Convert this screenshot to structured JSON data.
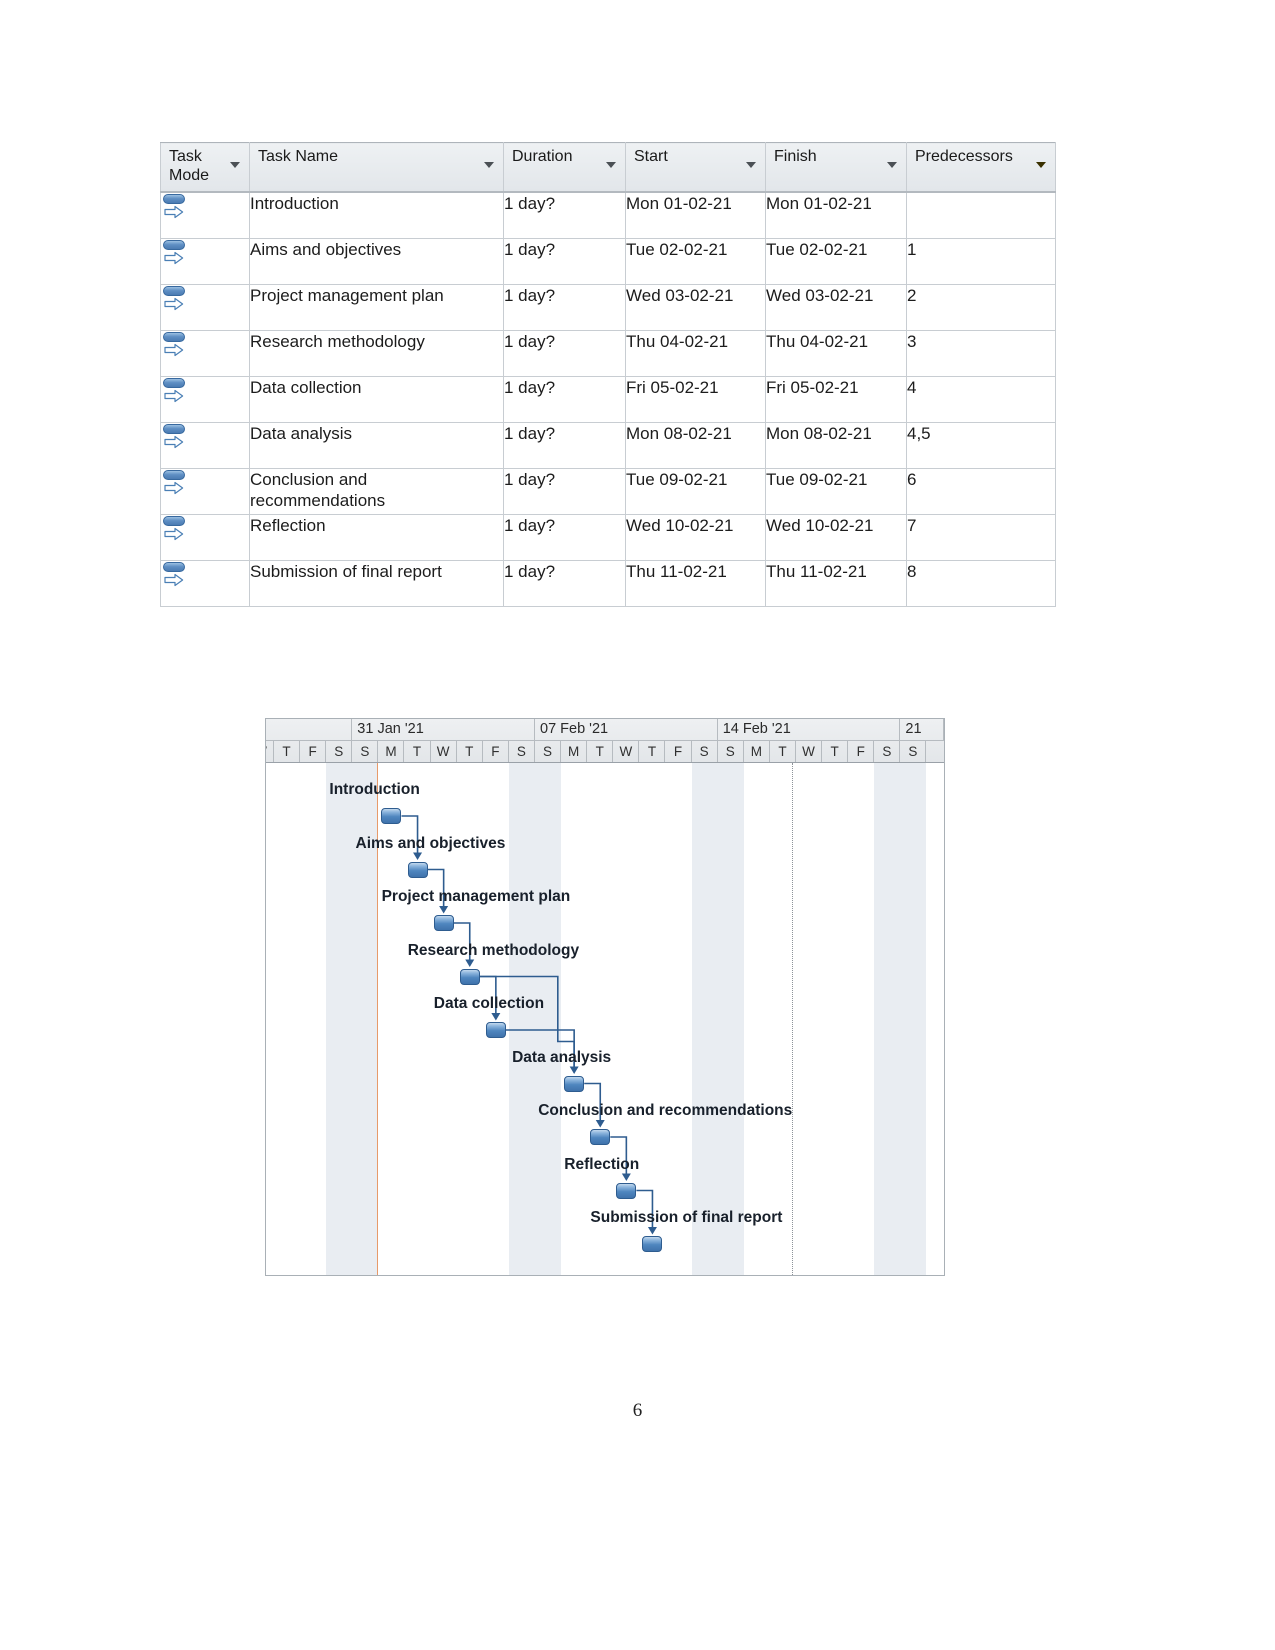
{
  "table": {
    "columns": [
      {
        "id": "task_mode",
        "label": "Task Mode",
        "has_filter": true,
        "highlight": false
      },
      {
        "id": "task_name",
        "label": "Task Name",
        "has_filter": true,
        "highlight": false
      },
      {
        "id": "duration",
        "label": "Duration",
        "has_filter": true,
        "highlight": false
      },
      {
        "id": "start",
        "label": "Start",
        "has_filter": true,
        "highlight": false
      },
      {
        "id": "finish",
        "label": "Finish",
        "has_filter": true,
        "highlight": false
      },
      {
        "id": "predecessors",
        "label": "Predecessors",
        "has_filter": true,
        "highlight": true
      }
    ],
    "highlight_color": "#ffd966",
    "rows": [
      {
        "mode_icon": "manually-scheduled-icon",
        "name": "Introduction",
        "duration": "1 day?",
        "start": "Mon 01-02-21",
        "finish": "Mon 01-02-21",
        "predecessors": ""
      },
      {
        "mode_icon": "manually-scheduled-icon",
        "name": "Aims and objectives",
        "duration": "1 day?",
        "start": "Tue 02-02-21",
        "finish": "Tue 02-02-21",
        "predecessors": "1"
      },
      {
        "mode_icon": "manually-scheduled-icon",
        "name": "Project management plan",
        "duration": "1 day?",
        "start": "Wed 03-02-21",
        "finish": "Wed 03-02-21",
        "predecessors": "2"
      },
      {
        "mode_icon": "manually-scheduled-icon",
        "name": "Research methodology",
        "duration": "1 day?",
        "start": "Thu 04-02-21",
        "finish": "Thu 04-02-21",
        "predecessors": "3"
      },
      {
        "mode_icon": "manually-scheduled-icon",
        "name": "Data collection",
        "duration": "1 day?",
        "start": "Fri 05-02-21",
        "finish": "Fri 05-02-21",
        "predecessors": "4"
      },
      {
        "mode_icon": "manually-scheduled-icon",
        "name": "Data analysis",
        "duration": "1 day?",
        "start": "Mon 08-02-21",
        "finish": "Mon 08-02-21",
        "predecessors": "4,5"
      },
      {
        "mode_icon": "manually-scheduled-icon",
        "name": "Conclusion and recommendations",
        "duration": "1 day?",
        "start": "Tue 09-02-21",
        "finish": "Tue 09-02-21",
        "predecessors": "6"
      },
      {
        "mode_icon": "manually-scheduled-icon",
        "name": "Reflection",
        "duration": "1 day?",
        "start": "Wed 10-02-21",
        "finish": "Wed 10-02-21",
        "predecessors": "7"
      },
      {
        "mode_icon": "manually-scheduled-icon",
        "name": "Submission of final report",
        "duration": "1 day?",
        "start": "Thu 11-02-21",
        "finish": "Thu 11-02-21",
        "predecessors": "8"
      }
    ]
  },
  "chart_data": {
    "type": "gantt",
    "title": "",
    "timeline": {
      "weeks": [
        "31 Jan '21",
        "07 Feb '21",
        "14 Feb '21",
        "21"
      ],
      "day_letters": [
        "W",
        "T",
        "F",
        "S",
        "S",
        "M",
        "T",
        "W",
        "T",
        "F",
        "S",
        "S",
        "M",
        "T",
        "W",
        "T",
        "F",
        "S",
        "S",
        "M",
        "T",
        "W",
        "T",
        "F",
        "S",
        "S"
      ],
      "weekend_indices": [
        3,
        4,
        10,
        11,
        17,
        18,
        24,
        25
      ]
    },
    "tasks": [
      {
        "name": "Introduction",
        "label": "Introduction",
        "start_index": 5,
        "length_days": 1,
        "predecessor": null
      },
      {
        "name": "Aims and objectives",
        "label": "Aims and objectives",
        "start_index": 6,
        "length_days": 1,
        "predecessor": "Introduction"
      },
      {
        "name": "Project management plan",
        "label": "Project management plan",
        "start_index": 7,
        "length_days": 1,
        "predecessor": "Aims and objectives"
      },
      {
        "name": "Research methodology",
        "label": "Research methodology",
        "start_index": 8,
        "length_days": 1,
        "predecessor": "Project management plan"
      },
      {
        "name": "Data collection",
        "label": "Data collection",
        "start_index": 9,
        "length_days": 1,
        "predecessor": "Research methodology"
      },
      {
        "name": "Data analysis",
        "label": "Data analysis",
        "start_index": 12,
        "length_days": 1,
        "predecessor": "Data collection"
      },
      {
        "name": "Conclusion and recommendations",
        "label": "Conclusion and recommendations",
        "start_index": 13,
        "length_days": 1,
        "predecessor": "Data analysis"
      },
      {
        "name": "Reflection",
        "label": "Reflection",
        "start_index": 14,
        "length_days": 1,
        "predecessor": "Conclusion and recommendations"
      },
      {
        "name": "Submission of final report",
        "label": "Submission of final report",
        "start_index": 15,
        "length_days": 1,
        "predecessor": "Reflection"
      }
    ],
    "bar_color": "#4f86bf",
    "today_marker": true
  },
  "page": {
    "number": "6"
  }
}
